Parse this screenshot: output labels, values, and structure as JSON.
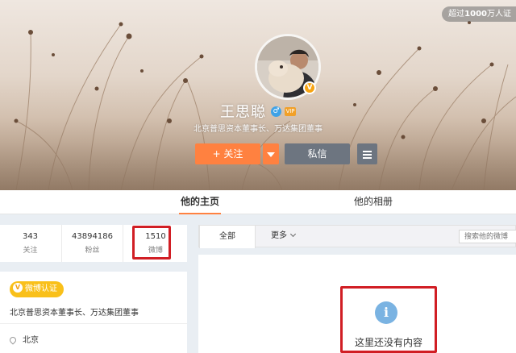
{
  "header": {
    "corner_badge_prefix": "超过",
    "corner_badge_bold": "1000",
    "corner_badge_suffix": "万人证",
    "name": "王思聪",
    "gender_icon": "male-icon",
    "vip_icon": "vip-icon",
    "description": "北京普思资本董事长、万达集团董事",
    "follow_label": "+ 关注",
    "message_label": "私信"
  },
  "tabs": {
    "home": "他的主页",
    "album": "他的相册"
  },
  "stats": [
    {
      "value": "343",
      "label": "关注"
    },
    {
      "value": "43894186",
      "label": "粉丝"
    },
    {
      "value": "1510",
      "label": "微博"
    }
  ],
  "profile": {
    "verify_badge": "微博认证",
    "verify_text": "北京普思资本董事长、万达集团董事",
    "location": "北京"
  },
  "feed": {
    "tab_all": "全部",
    "more_label": "更多",
    "search_placeholder": "搜索他的微博",
    "empty_text": "这里还没有内容"
  },
  "colors": {
    "accent_orange": "#ff8140",
    "highlight_red": "#d11e24",
    "verify_yellow": "#f9c01a",
    "info_blue": "#7ab3e2"
  }
}
